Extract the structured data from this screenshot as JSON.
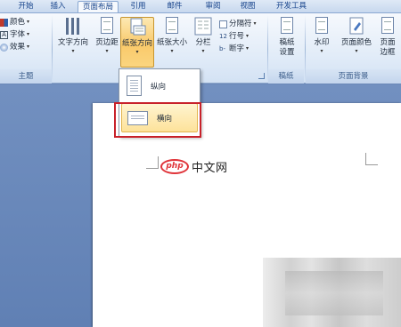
{
  "tabs": [
    {
      "label": "开始",
      "active": false
    },
    {
      "label": "插入",
      "active": false
    },
    {
      "label": "页面布局",
      "active": true
    },
    {
      "label": "引用",
      "active": false
    },
    {
      "label": "邮件",
      "active": false
    },
    {
      "label": "审阅",
      "active": false
    },
    {
      "label": "视图",
      "active": false
    },
    {
      "label": "开发工具",
      "active": false
    }
  ],
  "theme_group": {
    "colors": "颜色",
    "fonts": "字体",
    "effects": "效果",
    "label": "主题"
  },
  "page_setup_group": {
    "text_direction": "文字方向",
    "margins": "页边距",
    "orientation": "纸张方向",
    "size": "纸张大小",
    "columns": "分栏",
    "breaks": "分隔符",
    "line_numbers": "行号",
    "hyphenation": "断字"
  },
  "draft_group": {
    "draft_settings_line1": "稿纸",
    "draft_settings_line2": "设置",
    "label": "稿纸"
  },
  "page_background_group": {
    "watermark": "水印",
    "page_color": "页面颜色",
    "page_borders_line1": "页面",
    "page_borders_line2": "边框",
    "label": "页面背景"
  },
  "orientation_menu": {
    "portrait": "纵向",
    "landscape": "横向",
    "highlighted": "横向"
  },
  "watermark_overlay": {
    "badge": "php",
    "text": "中文网"
  },
  "colors": {
    "accent_red": "#c8212a",
    "ribbon_blue": "#15428b",
    "workspace": "#6b88b8"
  }
}
